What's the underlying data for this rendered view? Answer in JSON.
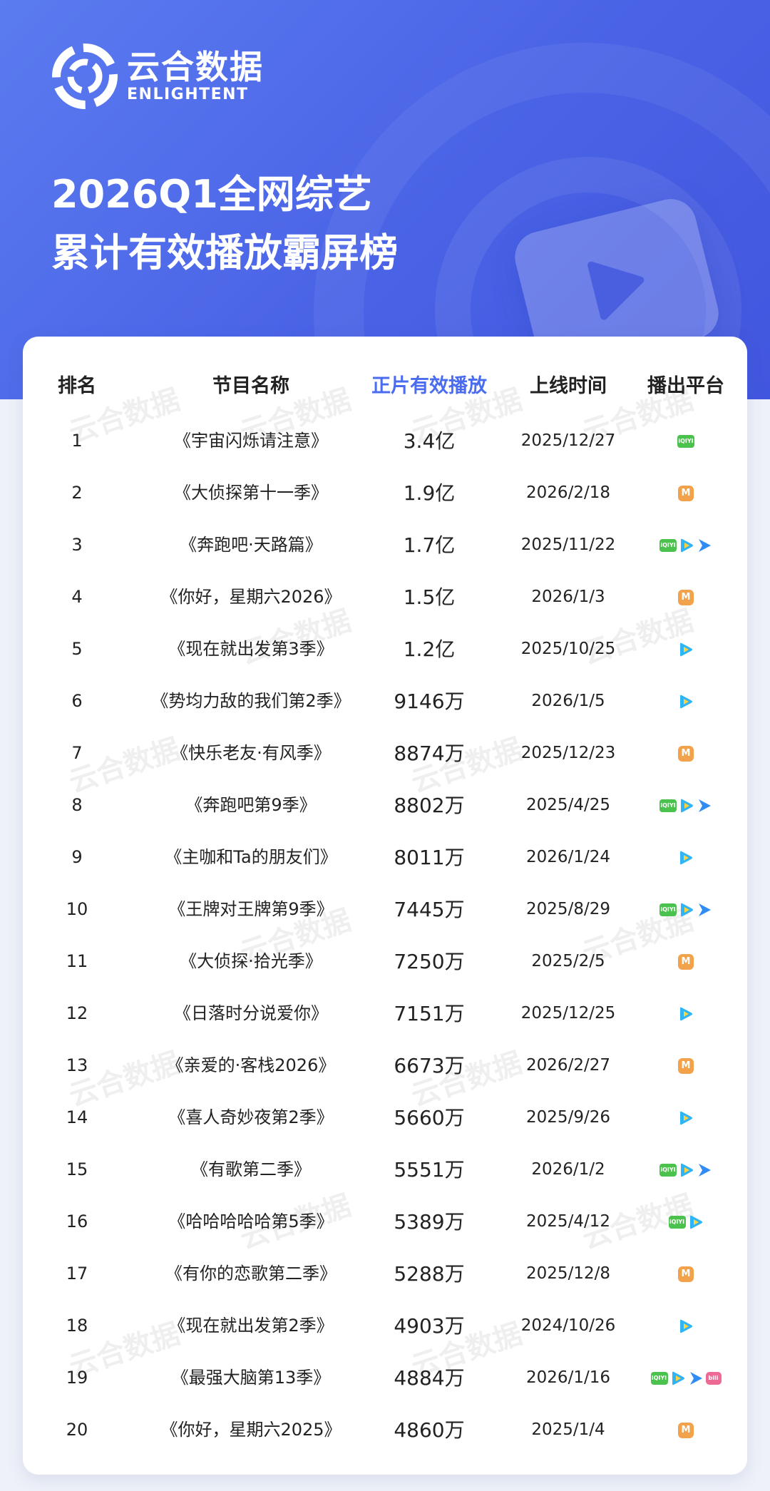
{
  "brand": {
    "name_cn": "云合数据",
    "name_en": "ENLIGHTENT"
  },
  "title": {
    "line1": "2026Q1全网综艺",
    "line2": "累计有效播放霸屏榜"
  },
  "table": {
    "headers": {
      "rank": "排名",
      "name": "节目名称",
      "plays": "正片有效播放",
      "date": "上线时间",
      "platform": "播出平台"
    },
    "rows": [
      {
        "rank": "1",
        "name": "《宇宙闪烁请注意》",
        "plays": "3.4亿",
        "date": "2025/12/27",
        "platforms": [
          "iqiyi"
        ]
      },
      {
        "rank": "2",
        "name": "《大侦探第十一季》",
        "plays": "1.9亿",
        "date": "2026/2/18",
        "platforms": [
          "mango"
        ]
      },
      {
        "rank": "3",
        "name": "《奔跑吧·天路篇》",
        "plays": "1.7亿",
        "date": "2025/11/22",
        "platforms": [
          "iqiyi",
          "tencent",
          "youku"
        ]
      },
      {
        "rank": "4",
        "name": "《你好，星期六2026》",
        "plays": "1.5亿",
        "date": "2026/1/3",
        "platforms": [
          "mango"
        ]
      },
      {
        "rank": "5",
        "name": "《现在就出发第3季》",
        "plays": "1.2亿",
        "date": "2025/10/25",
        "platforms": [
          "tencent"
        ]
      },
      {
        "rank": "6",
        "name": "《势均力敌的我们第2季》",
        "plays": "9146万",
        "date": "2026/1/5",
        "platforms": [
          "tencent"
        ]
      },
      {
        "rank": "7",
        "name": "《快乐老友·有风季》",
        "plays": "8874万",
        "date": "2025/12/23",
        "platforms": [
          "mango"
        ]
      },
      {
        "rank": "8",
        "name": "《奔跑吧第9季》",
        "plays": "8802万",
        "date": "2025/4/25",
        "platforms": [
          "iqiyi",
          "tencent",
          "youku"
        ]
      },
      {
        "rank": "9",
        "name": "《主咖和Ta的朋友们》",
        "plays": "8011万",
        "date": "2026/1/24",
        "platforms": [
          "tencent"
        ]
      },
      {
        "rank": "10",
        "name": "《王牌对王牌第9季》",
        "plays": "7445万",
        "date": "2025/8/29",
        "platforms": [
          "iqiyi",
          "tencent",
          "youku"
        ]
      },
      {
        "rank": "11",
        "name": "《大侦探·拾光季》",
        "plays": "7250万",
        "date": "2025/2/5",
        "platforms": [
          "mango"
        ]
      },
      {
        "rank": "12",
        "name": "《日落时分说爱你》",
        "plays": "7151万",
        "date": "2025/12/25",
        "platforms": [
          "tencent"
        ]
      },
      {
        "rank": "13",
        "name": "《亲爱的·客栈2026》",
        "plays": "6673万",
        "date": "2026/2/27",
        "platforms": [
          "mango"
        ]
      },
      {
        "rank": "14",
        "name": "《喜人奇妙夜第2季》",
        "plays": "5660万",
        "date": "2025/9/26",
        "platforms": [
          "tencent"
        ]
      },
      {
        "rank": "15",
        "name": "《有歌第二季》",
        "plays": "5551万",
        "date": "2026/1/2",
        "platforms": [
          "iqiyi",
          "tencent",
          "youku"
        ]
      },
      {
        "rank": "16",
        "name": "《哈哈哈哈哈第5季》",
        "plays": "5389万",
        "date": "2025/4/12",
        "platforms": [
          "iqiyi",
          "tencent"
        ]
      },
      {
        "rank": "17",
        "name": "《有你的恋歌第二季》",
        "plays": "5288万",
        "date": "2025/12/8",
        "platforms": [
          "mango"
        ]
      },
      {
        "rank": "18",
        "name": "《现在就出发第2季》",
        "plays": "4903万",
        "date": "2024/10/26",
        "platforms": [
          "tencent"
        ]
      },
      {
        "rank": "19",
        "name": "《最强大脑第13季》",
        "plays": "4884万",
        "date": "2026/1/16",
        "platforms": [
          "iqiyi",
          "tencent",
          "youku",
          "bilibili"
        ]
      },
      {
        "rank": "20",
        "name": "《你好，星期六2025》",
        "plays": "4860万",
        "date": "2025/1/4",
        "platforms": [
          "mango"
        ]
      }
    ]
  },
  "platform_icons": {
    "iqiyi": {
      "icon": "iqiyi-icon",
      "label": "iQIYI",
      "color": "#4bc24d"
    },
    "mango": {
      "icon": "mango-tv-icon",
      "color": "#f2a24a"
    },
    "tencent": {
      "icon": "tencent-video-icon",
      "color": "#2fb4f5"
    },
    "youku": {
      "icon": "youku-icon",
      "color": "#2f8cf5"
    },
    "bilibili": {
      "icon": "bilibili-icon",
      "label": "bili",
      "color": "#ec6a94"
    }
  },
  "colors": {
    "hero_bg": "#4a63e6",
    "header_accent": "#4a6cf0",
    "text": "#222222"
  }
}
